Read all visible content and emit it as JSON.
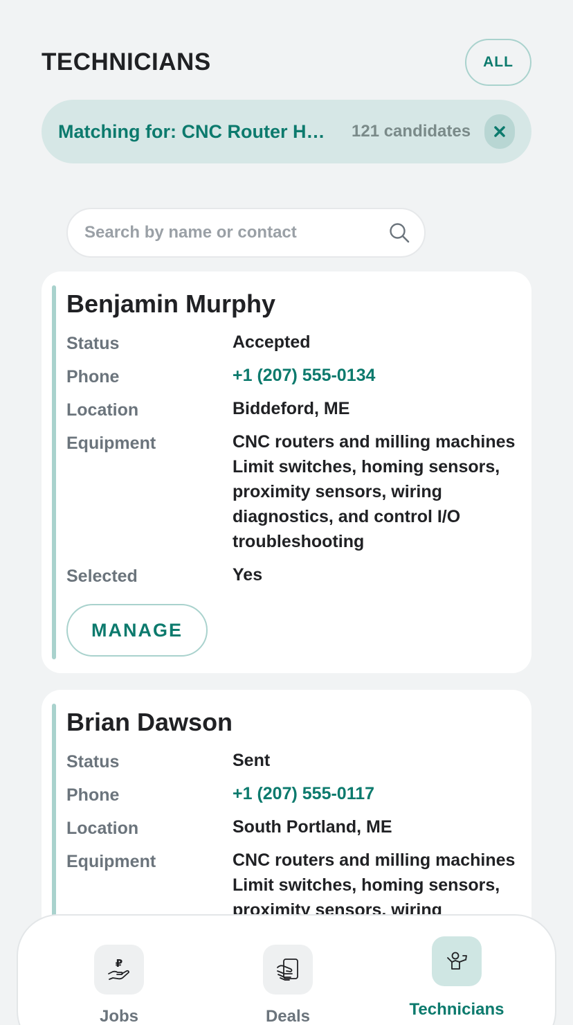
{
  "header": {
    "title": "TECHNICIANS",
    "filter_label": "ALL"
  },
  "match": {
    "text": "Matching for: CNC Router Homing Sensor Repair",
    "count": "121 candidates",
    "close_symbol": "×"
  },
  "search": {
    "placeholder": "Search by name or contact"
  },
  "labels": {
    "status": "Status",
    "phone": "Phone",
    "location": "Location",
    "equipment": "Equipment",
    "selected": "Selected"
  },
  "technicians": [
    {
      "name": "Benjamin Murphy",
      "status": "Accepted",
      "phone": "+1 (207) 555-0134",
      "location": "Biddeford, ME",
      "equipment": "CNC routers and milling machines Limit switches, homing sensors, proximity sensors, wiring diagnostics, and control I/O troubleshooting",
      "selected": "Yes",
      "action_label": "MANAGE"
    },
    {
      "name": "Brian Dawson",
      "status": "Sent",
      "phone": "+1 (207) 555-0117",
      "location": "South Portland, ME",
      "equipment": "CNC routers and milling machines Limit switches, homing sensors, proximity sensors, wiring diagnostics, and control I/O troubleshooting"
    }
  ],
  "nav": {
    "items": [
      {
        "label": "Jobs",
        "icon": "ruble-hand-icon",
        "active": false
      },
      {
        "label": "Deals",
        "icon": "handshake-document-icon",
        "active": false
      },
      {
        "label": "Technicians",
        "icon": "technician-icon",
        "active": true
      }
    ]
  },
  "colors": {
    "accent": "#0c7a6d",
    "banner_bg": "#d6e7e6",
    "page_bg": "#f1f3f4",
    "card_bar": "#a9d2cd"
  }
}
